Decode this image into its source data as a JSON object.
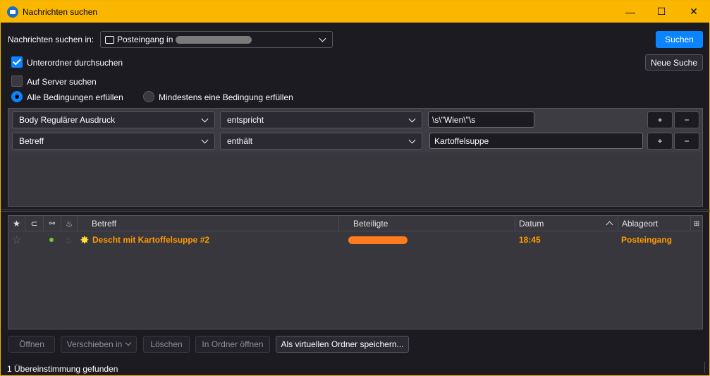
{
  "window": {
    "title": "Nachrichten suchen",
    "minimize": "—",
    "maximize": "☐",
    "close": "✕"
  },
  "search_in": {
    "label": "Nachrichten suchen in:",
    "folder": "Posteingang in"
  },
  "buttons": {
    "search": "Suchen",
    "new_search": "Neue Suche"
  },
  "options": {
    "subfolders": "Unterordner durchsuchen",
    "subfolders_checked": true,
    "server": "Auf Server suchen",
    "server_checked": false,
    "match_all": "Alle Bedingungen erfüllen",
    "match_any": "Mindestens eine Bedingung erfüllen",
    "selected": "match_all"
  },
  "conditions": [
    {
      "field": "Body Regulärer Ausdruck",
      "operator": "entspricht",
      "value": "\\s\\\"Wien\\\"\\s",
      "add": "+",
      "remove": "−"
    },
    {
      "field": "Betreff",
      "operator": "enthält",
      "value": "Kartoffelsuppe",
      "add": "+",
      "remove": "−"
    }
  ],
  "table": {
    "columns": [
      "Betreff",
      "Beteiligte",
      "Datum",
      "Ablageort"
    ],
    "rows": [
      {
        "subject": "Descht mit Kartoffelsuppe #2",
        "date": "18:45",
        "location": "Posteingang"
      }
    ]
  },
  "actions": {
    "open": "Öffnen",
    "move": "Verschieben in",
    "delete": "Löschen",
    "open_folder": "In Ordner öffnen",
    "save_virtual": "Als virtuellen Ordner speichern..."
  },
  "status": "1 Übereinstimmung gefunden",
  "colors": {
    "accent": "#0a84ff",
    "titlebar": "#fbb700",
    "unread": "#ff9a00"
  }
}
